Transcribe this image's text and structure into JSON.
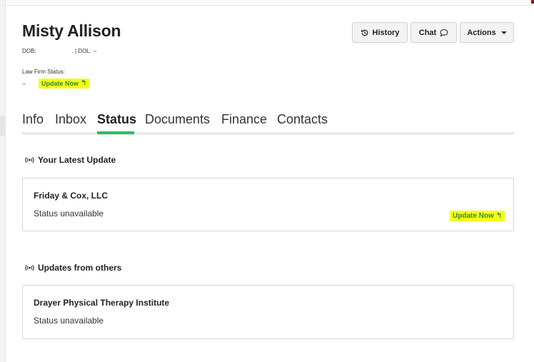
{
  "client": {
    "name": "Misty Allison",
    "dob_line_start": "DOB:",
    "dob_line_end": ". | DOL: --",
    "law_firm_status_label": "Law Firm Status:",
    "law_firm_status_value": "--",
    "update_now_label": "Update Now"
  },
  "toolbar": {
    "history_label": "History",
    "chat_label": "Chat",
    "actions_label": "Actions"
  },
  "tabs": [
    {
      "label": "Info"
    },
    {
      "label": "Inbox"
    },
    {
      "label": "Status"
    },
    {
      "label": "Documents"
    },
    {
      "label": "Finance"
    },
    {
      "label": "Contacts"
    }
  ],
  "active_tab": "Status",
  "sections": {
    "latest": {
      "title": "Your Latest Update",
      "card": {
        "firm": "Friday & Cox, LLC",
        "status": "Status unavailable",
        "update_label": "Update Now"
      }
    },
    "others": {
      "title": "Updates from others",
      "card": {
        "firm": "Drayer Physical Therapy Institute",
        "status": "Status unavailable"
      }
    }
  },
  "colors": {
    "highlight": "#f4ff1a",
    "update_text": "#3a8a1e",
    "active_tab_underline": "#2fb86a",
    "tab_rail": "#e8e9ea"
  },
  "icons": {
    "history": "history-icon",
    "chat": "chat-bubble-icon",
    "actions": "caret-down-icon",
    "update": "reply-arrow-icon",
    "broadcast": "broadcast-icon"
  }
}
